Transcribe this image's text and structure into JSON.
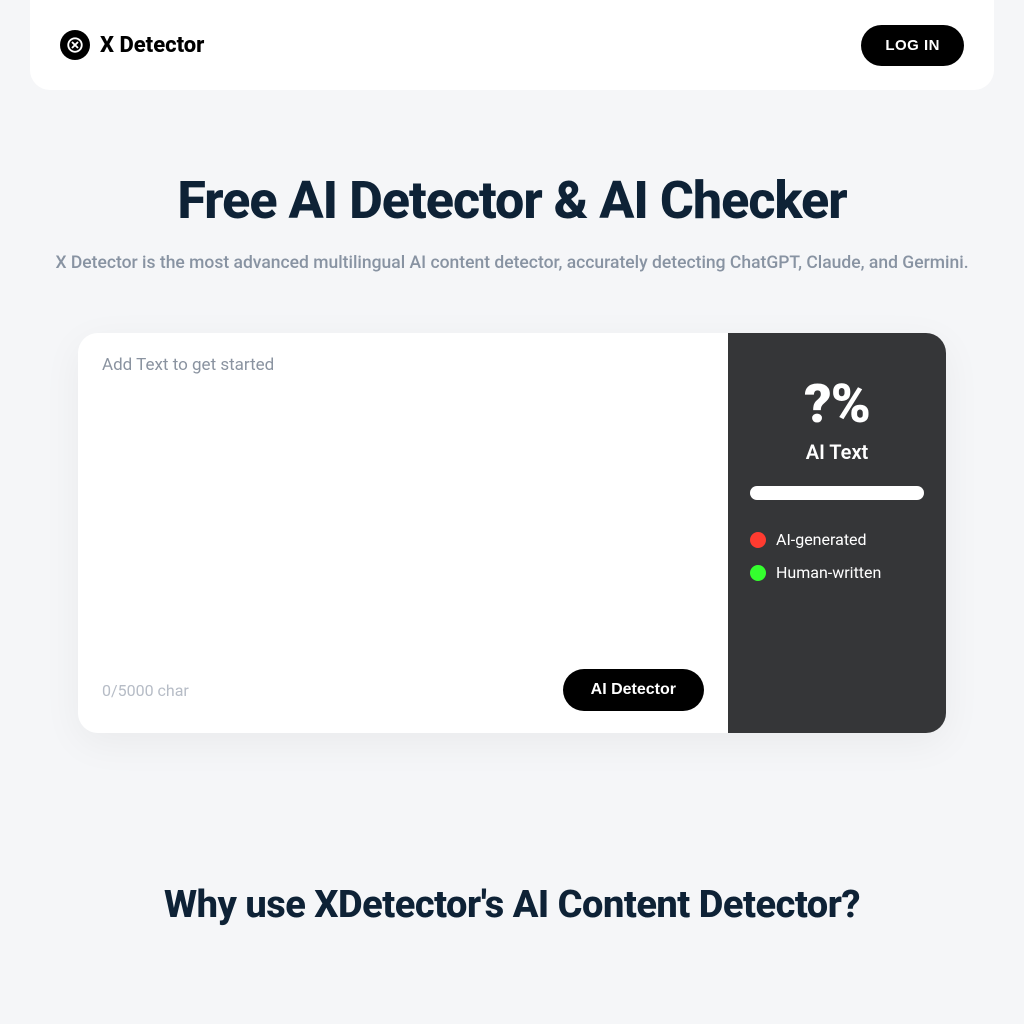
{
  "header": {
    "brand": "X Detector",
    "login": "LOG IN"
  },
  "hero": {
    "title": "Free AI Detector & AI Checker",
    "subtitle": "X Detector is the most advanced multilingual AI content detector, accurately detecting ChatGPT, Claude, and Germini."
  },
  "input": {
    "placeholder": "Add Text to get started",
    "char_count": "0/5000 char",
    "button": "AI Detector"
  },
  "result": {
    "percent": "?%",
    "label": "AI Text",
    "legend_ai": "AI-generated",
    "legend_human": "Human-written"
  },
  "section2": {
    "title": "Why use XDetector's AI Content Detector?"
  }
}
